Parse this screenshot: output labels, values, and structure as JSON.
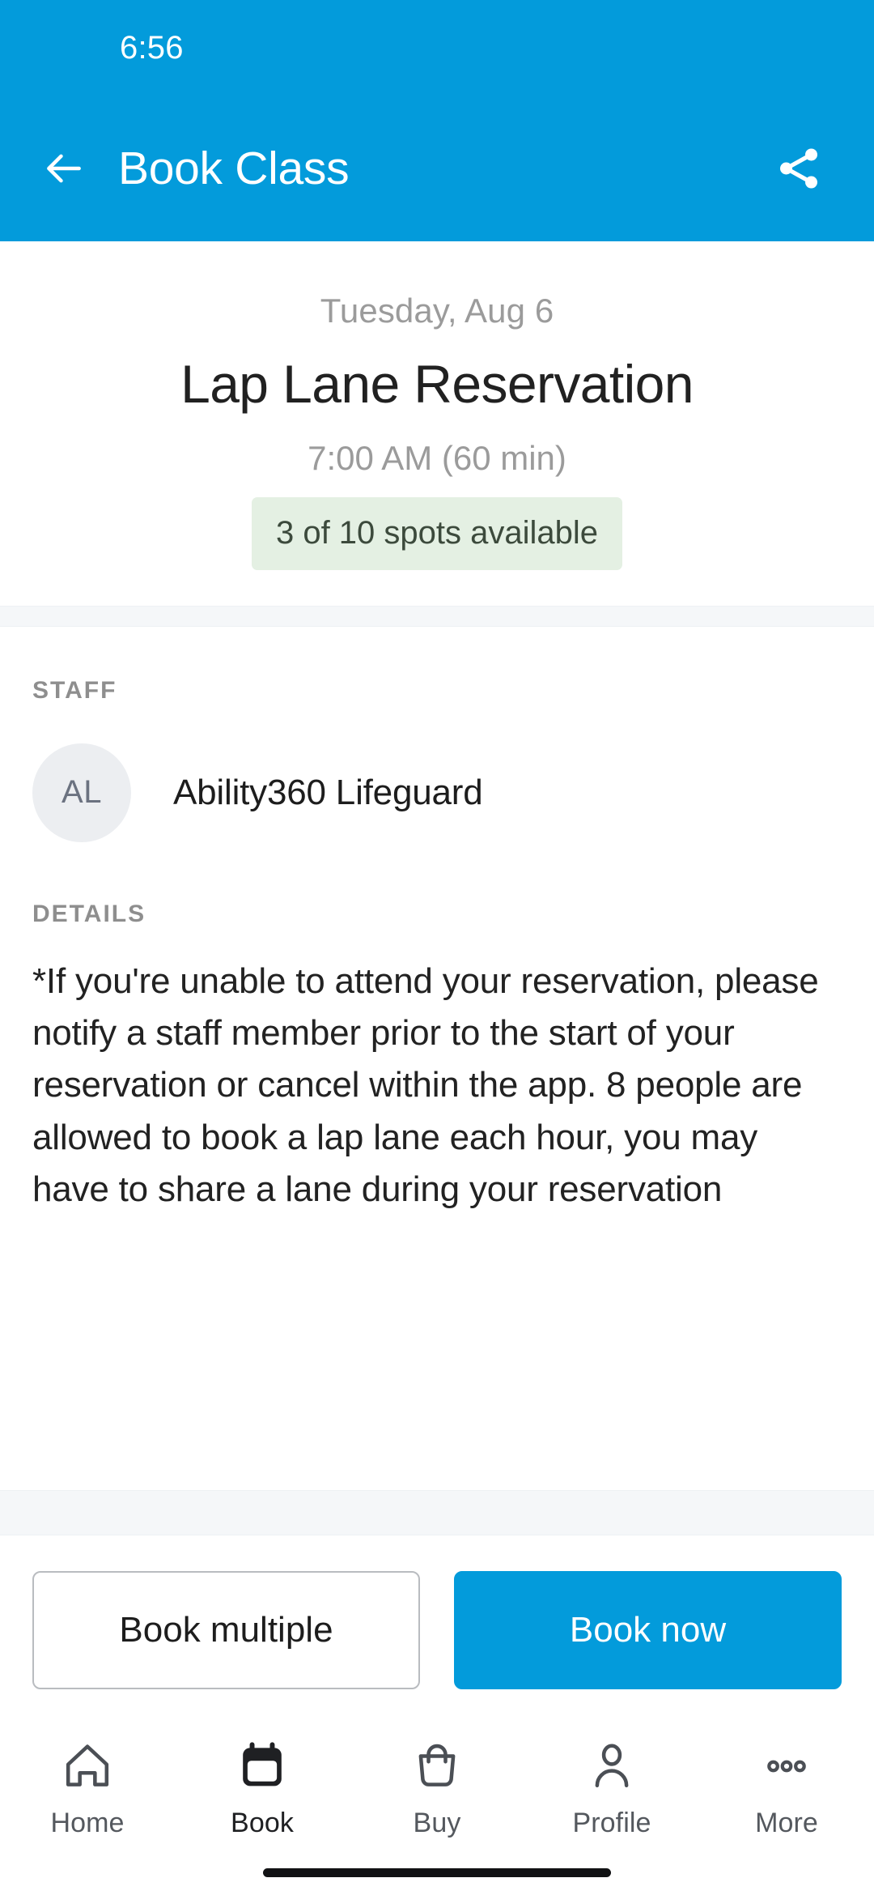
{
  "theme": {
    "accent": "#039BDB",
    "badge_bg": "#E4F0E3",
    "badge_text": "#3c4a3c",
    "avatar_bg": "#ECEEF1",
    "band_bg": "#F5F7F9"
  },
  "status_bar": {
    "time": "6:56"
  },
  "app_bar": {
    "title": "Book Class",
    "back_icon": "arrow-left-icon",
    "share_icon": "share-icon"
  },
  "hero": {
    "date": "Tuesday, Aug 6",
    "title": "Lap Lane Reservation",
    "time": "7:00 AM (60 min)",
    "spots_badge": "3 of 10 spots available"
  },
  "staff": {
    "label": "STAFF",
    "members": [
      {
        "initials": "AL",
        "name": "Ability360 Lifeguard"
      }
    ]
  },
  "details": {
    "label": "DETAILS",
    "text": "*If you're unable to attend your reservation, please notify a staff member prior to the start of your reservation or cancel within the app. 8 people are allowed to book a lap lane each hour, you may have to share a lane during your reservation"
  },
  "actions": {
    "book_multiple": "Book multiple",
    "book_now": "Book now"
  },
  "bottom_nav": {
    "items": [
      {
        "label": "Home",
        "icon": "home-icon",
        "active": false
      },
      {
        "label": "Book",
        "icon": "calendar-icon",
        "active": true
      },
      {
        "label": "Buy",
        "icon": "bag-icon",
        "active": false
      },
      {
        "label": "Profile",
        "icon": "person-icon",
        "active": false
      },
      {
        "label": "More",
        "icon": "ellipsis-icon",
        "active": false
      }
    ]
  }
}
